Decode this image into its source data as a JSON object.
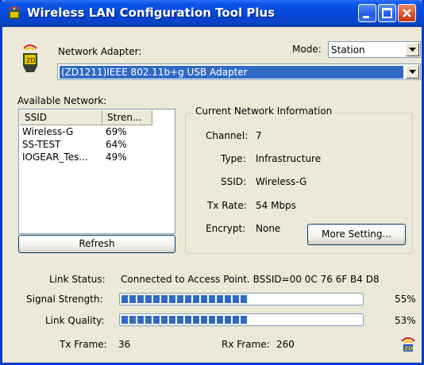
{
  "window": {
    "title": "Wireless LAN Configuration Tool Plus"
  },
  "adapter": {
    "label": "Network Adapter:",
    "value": "(ZD1211)IEEE 802.11b+g USB Adapter"
  },
  "mode": {
    "label": "Mode:",
    "value": "Station"
  },
  "available": {
    "label": "Available Network:",
    "columns": [
      "SSID",
      "Stren..."
    ],
    "rows": [
      {
        "ssid": "Wireless-G",
        "strength": "69%"
      },
      {
        "ssid": "SS-TEST",
        "strength": "64%"
      },
      {
        "ssid": "IOGEAR_Tes...",
        "strength": "49%"
      }
    ],
    "refresh_label": "Refresh"
  },
  "current": {
    "title": "Current Network Information",
    "channel_label": "Channel:",
    "channel": "7",
    "type_label": "Type:",
    "type": "Infrastructure",
    "ssid_label": "SSID:",
    "ssid": "Wireless-G",
    "txrate_label": "Tx Rate:",
    "txrate": "54 Mbps",
    "encrypt_label": "Encrypt:",
    "encrypt": "None",
    "more_label": "More Setting..."
  },
  "status": {
    "link_status_label": "Link Status:",
    "link_status": "Connected to Access Point. BSSID=00 0C 76 6F B4 D8",
    "signal_label": "Signal Strength:",
    "signal_text": "55%",
    "signal_value": 55,
    "quality_label": "Link Quality:",
    "quality_text": "53%",
    "quality_value": 53,
    "tx_label": "Tx Frame:",
    "tx": "36",
    "rx_label": "Rx Frame:",
    "rx": "260"
  },
  "colors": {
    "titlebar": "#0a55e6",
    "progress_fill": "#316ac5",
    "selection": "#316ac5"
  },
  "icons": {
    "app": "wireless-adapter-icon",
    "tray": "zd-wireless-icon"
  }
}
